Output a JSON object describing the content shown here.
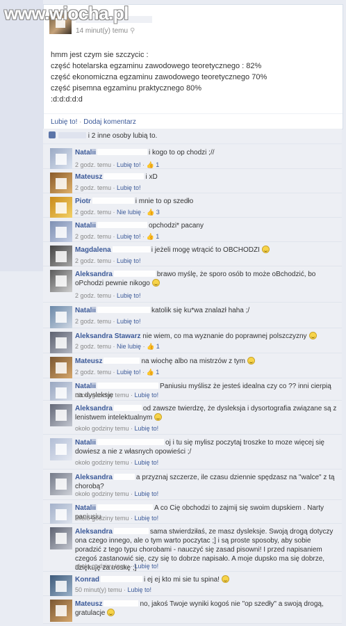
{
  "watermark": {
    "text": "www.wiocha.pl"
  },
  "post": {
    "author": "",
    "time": "14 minut(y) temu",
    "time_icon": "pin-icon",
    "body_lines": [
      "hmm jest czym sie szczycic :",
      "część hotelarska egzaminu zawodowego teoretycznego : 82%",
      "część ekonomiczna egzaminu zawodowego teoretycznego 70%",
      "część pisemna egzaminu praktycznego 80%",
      ":d:d:d:d:d"
    ],
    "like_action": "Lubię to!",
    "comment_action": "Dodaj komentarz",
    "likes_text": "i 2 inne osoby lubią to."
  },
  "comments": [
    {
      "author": "Natalii",
      "text": "i kogo to op chodzi ;//",
      "time": "2 godz. temu",
      "like": "Lubię to!",
      "count": "1"
    },
    {
      "author": "Mateusz",
      "text": "i xD",
      "time": "2 godz. temu",
      "like": "Lubię to!",
      "count": ""
    },
    {
      "author": "Piotr",
      "text": "i mnie to op szedło",
      "time": "2 godz. temu",
      "like": "Nie lubię",
      "count": "3"
    },
    {
      "author": "Natalii",
      "text": "opchodzi* pacany",
      "time": "2 godz. temu",
      "like": "Lubię to!",
      "count": "1"
    },
    {
      "author": "Magdalena",
      "text": "i jeżeli mogę wtrącić to OBCHODZI",
      "time": "2 godz. temu",
      "like": "Lubię to!",
      "count": ""
    },
    {
      "author": "Aleksandra",
      "text": "brawo  myślę, że sporo osób to może oBchodzić, bo oPchodzi pewnie nikogo",
      "time": "2 godz. temu",
      "like": "Lubię to!",
      "count": ""
    },
    {
      "author": "Natalii",
      "text": "katolik się ku*wa znalazł haha ;/",
      "time": "2 godz. temu",
      "like": "Lubię to!",
      "count": ""
    },
    {
      "author": "Aleksandra Stawarz",
      "text": "nie wiem, co ma wyznanie do poprawnej polszczyzny",
      "time": "2 godz. temu",
      "like": "Nie lubię",
      "count": "1"
    },
    {
      "author": "Mateusz",
      "text": "na wiochę albo na mistrzów z tym",
      "time": "2 godz. temu",
      "like": "Lubię to!",
      "count": "1"
    },
    {
      "author": "Natalii",
      "text": "Paniusiu myślisz że jesteś idealna czy co ?? inni cierpią na dysleksje",
      "time": "około godziny temu",
      "like": "Lubię to!",
      "count": ""
    },
    {
      "author": "Aleksandra",
      "text": "od zawsze twierdzę, że dysleksja i dysortografia związane są z lenistwem intelektualnym",
      "time": "około godziny temu",
      "like": "Lubię to!",
      "count": ""
    },
    {
      "author": "Natalii",
      "text": "oj i tu się mylisz poczytaj troszke to moze więcej się dowiesz a nie z własnych opowieści ;/",
      "time": "około godziny temu",
      "like": "Lubię to!",
      "count": ""
    },
    {
      "author": "Aleksandra",
      "text": "a przyznaj szczerze, ile czasu dziennie spędzasz na \"walce\" z tą chorobą?",
      "time": "około godziny temu",
      "like": "Lubię to!",
      "count": ""
    },
    {
      "author": "Natalii",
      "text": "A co Cię obchodzi to zajmij się swoim dupskiem . Narty paniusiu",
      "time": "około godziny temu",
      "like": "Lubię to!",
      "count": ""
    },
    {
      "author": "Aleksandra",
      "text": "sama stwierdziłaś, ze masz dysleksje. Swoją drogą dotyczy ona czego innego, ale o tym warto poczytac ;] i są proste sposoby, aby sobie poradzić z tego typu chorobami - nauczyć się zasad pisowni! I przed napisaniem czegoś zastanowić się, czy się to dobrze napisało. A moje dupsko ma się dobrze, dziękuję za troskę ;]",
      "time": "około godziny temu",
      "like": "Lubię to!",
      "count": ""
    },
    {
      "author": "Konrad",
      "text": "i ej ej kto mi sie tu spina!",
      "time": "50 minut(y) temu",
      "like": "Lubię to!",
      "count": ""
    },
    {
      "author": "Mateusz",
      "text": "no, jakoś Twoje wyniki kogoś nie \"op szedły\"  a swoją drogą, gratulacje",
      "time": "",
      "like": "",
      "count": ""
    }
  ]
}
